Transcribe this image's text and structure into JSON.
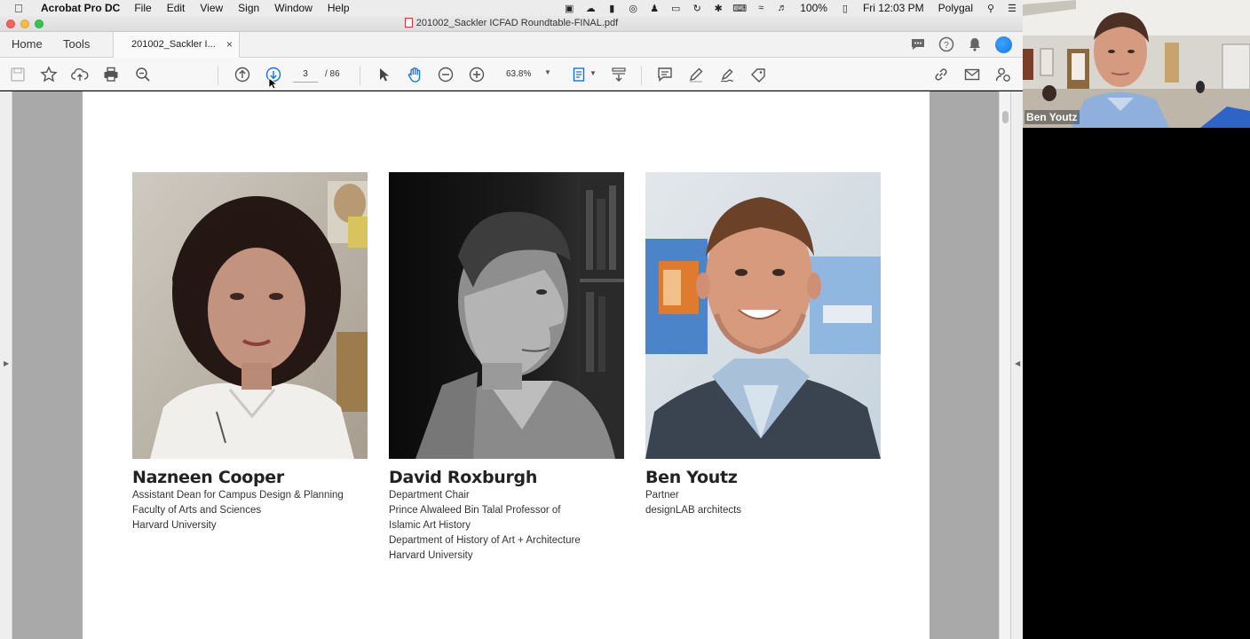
{
  "menubar": {
    "app_name": "Acrobat Pro DC",
    "menus": [
      "File",
      "Edit",
      "View",
      "Sign",
      "Window",
      "Help"
    ],
    "battery": "100%",
    "clock": "Fri 12:03 PM",
    "user": "Polygal"
  },
  "window": {
    "title": "201002_Sackler ICFAD Roundtable-FINAL.pdf"
  },
  "tabs": {
    "home": "Home",
    "tools": "Tools",
    "document": "201002_Sackler I...",
    "close": "×"
  },
  "toolbar": {
    "current_page": "3",
    "total_pages": "/ 86",
    "zoom": "63.8%"
  },
  "people": [
    {
      "name": "Nazneen Cooper",
      "lines": [
        "Assistant Dean for Campus Design & Planning",
        "Faculty of Arts and Sciences",
        "Harvard University"
      ]
    },
    {
      "name": "David Roxburgh",
      "lines": [
        "Department Chair",
        "Prince Alwaleed Bin Talal Professor of",
        "Islamic Art History",
        "Department of History of Art + Architecture",
        "Harvard University"
      ]
    },
    {
      "name": "Ben Youtz",
      "lines": [
        "Partner",
        "designLAB architects"
      ]
    }
  ],
  "video": {
    "participant_name": "Ben Youtz"
  },
  "colors": {
    "accent_blue": "#1473e6",
    "doc_background": "#a9a9a9",
    "page": "#ffffff"
  }
}
